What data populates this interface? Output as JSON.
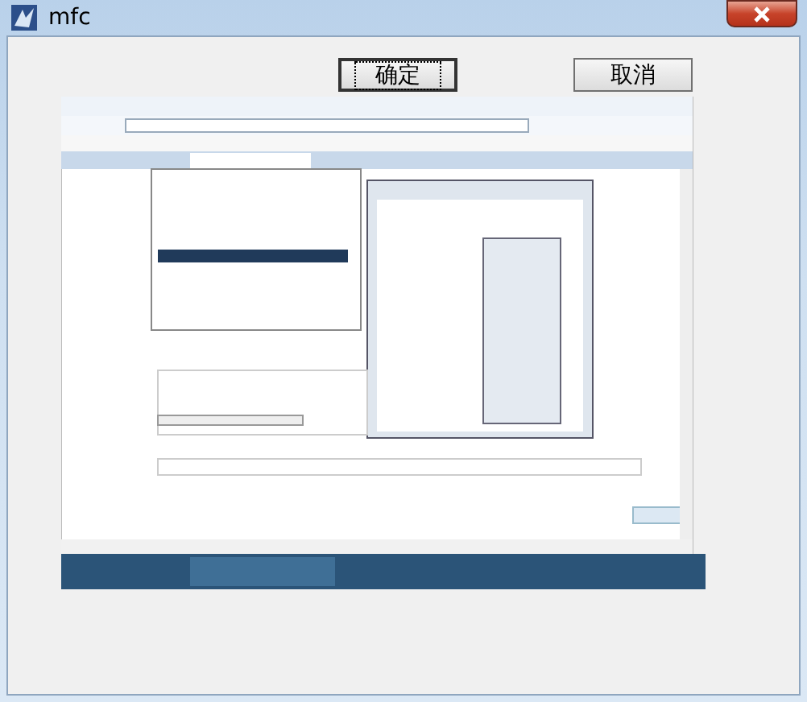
{
  "window": {
    "title": "mfc"
  },
  "buttons": [
    {
      "label": "确定",
      "focused": true
    },
    {
      "label": "取消",
      "focused": false
    }
  ]
}
